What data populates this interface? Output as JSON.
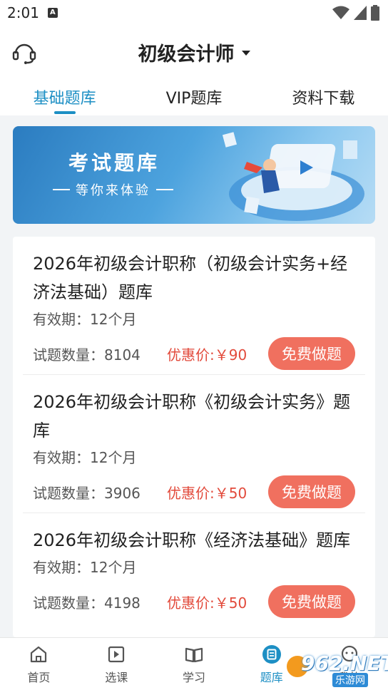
{
  "status_bar": {
    "time": "2:01",
    "notification_letter": "A"
  },
  "header": {
    "title": "初级会计师"
  },
  "tabs": [
    {
      "label": "基础题库",
      "active": true
    },
    {
      "label": "VIP题库",
      "active": false
    },
    {
      "label": "资料下载",
      "active": false
    }
  ],
  "banner": {
    "title": "考试题库",
    "subtitle": "等你来体验"
  },
  "items": [
    {
      "name": "2026年初级会计职称（初级会计实务+经济法基础）题库",
      "validity": "有效期：12个月",
      "count": "试题数量：8104",
      "price": "优惠价:￥90",
      "button": "免费做题"
    },
    {
      "name": "2026年初级会计职称《初级会计实务》题库",
      "validity": "有效期：12个月",
      "count": "试题数量：3906",
      "price": "优惠价:￥50",
      "button": "免费做题"
    },
    {
      "name": "2026年初级会计职称《经济法基础》题库",
      "validity": "有效期：12个月",
      "count": "试题数量：4198",
      "price": "优惠价:￥50",
      "button": "免费做题"
    }
  ],
  "bottom_nav": [
    {
      "label": "首页",
      "icon": "home-icon",
      "active": false
    },
    {
      "label": "选课",
      "icon": "course-icon",
      "active": false
    },
    {
      "label": "学习",
      "icon": "study-icon",
      "active": false
    },
    {
      "label": "题库",
      "icon": "question-bank-icon",
      "active": true
    },
    {
      "label": "我的",
      "icon": "profile-icon",
      "active": false
    }
  ],
  "watermark": {
    "main": "962.NET",
    "sub": "乐游网"
  },
  "colors": {
    "accent": "#1d8fc4",
    "price": "#e24a3b",
    "button": "#f0705f"
  }
}
